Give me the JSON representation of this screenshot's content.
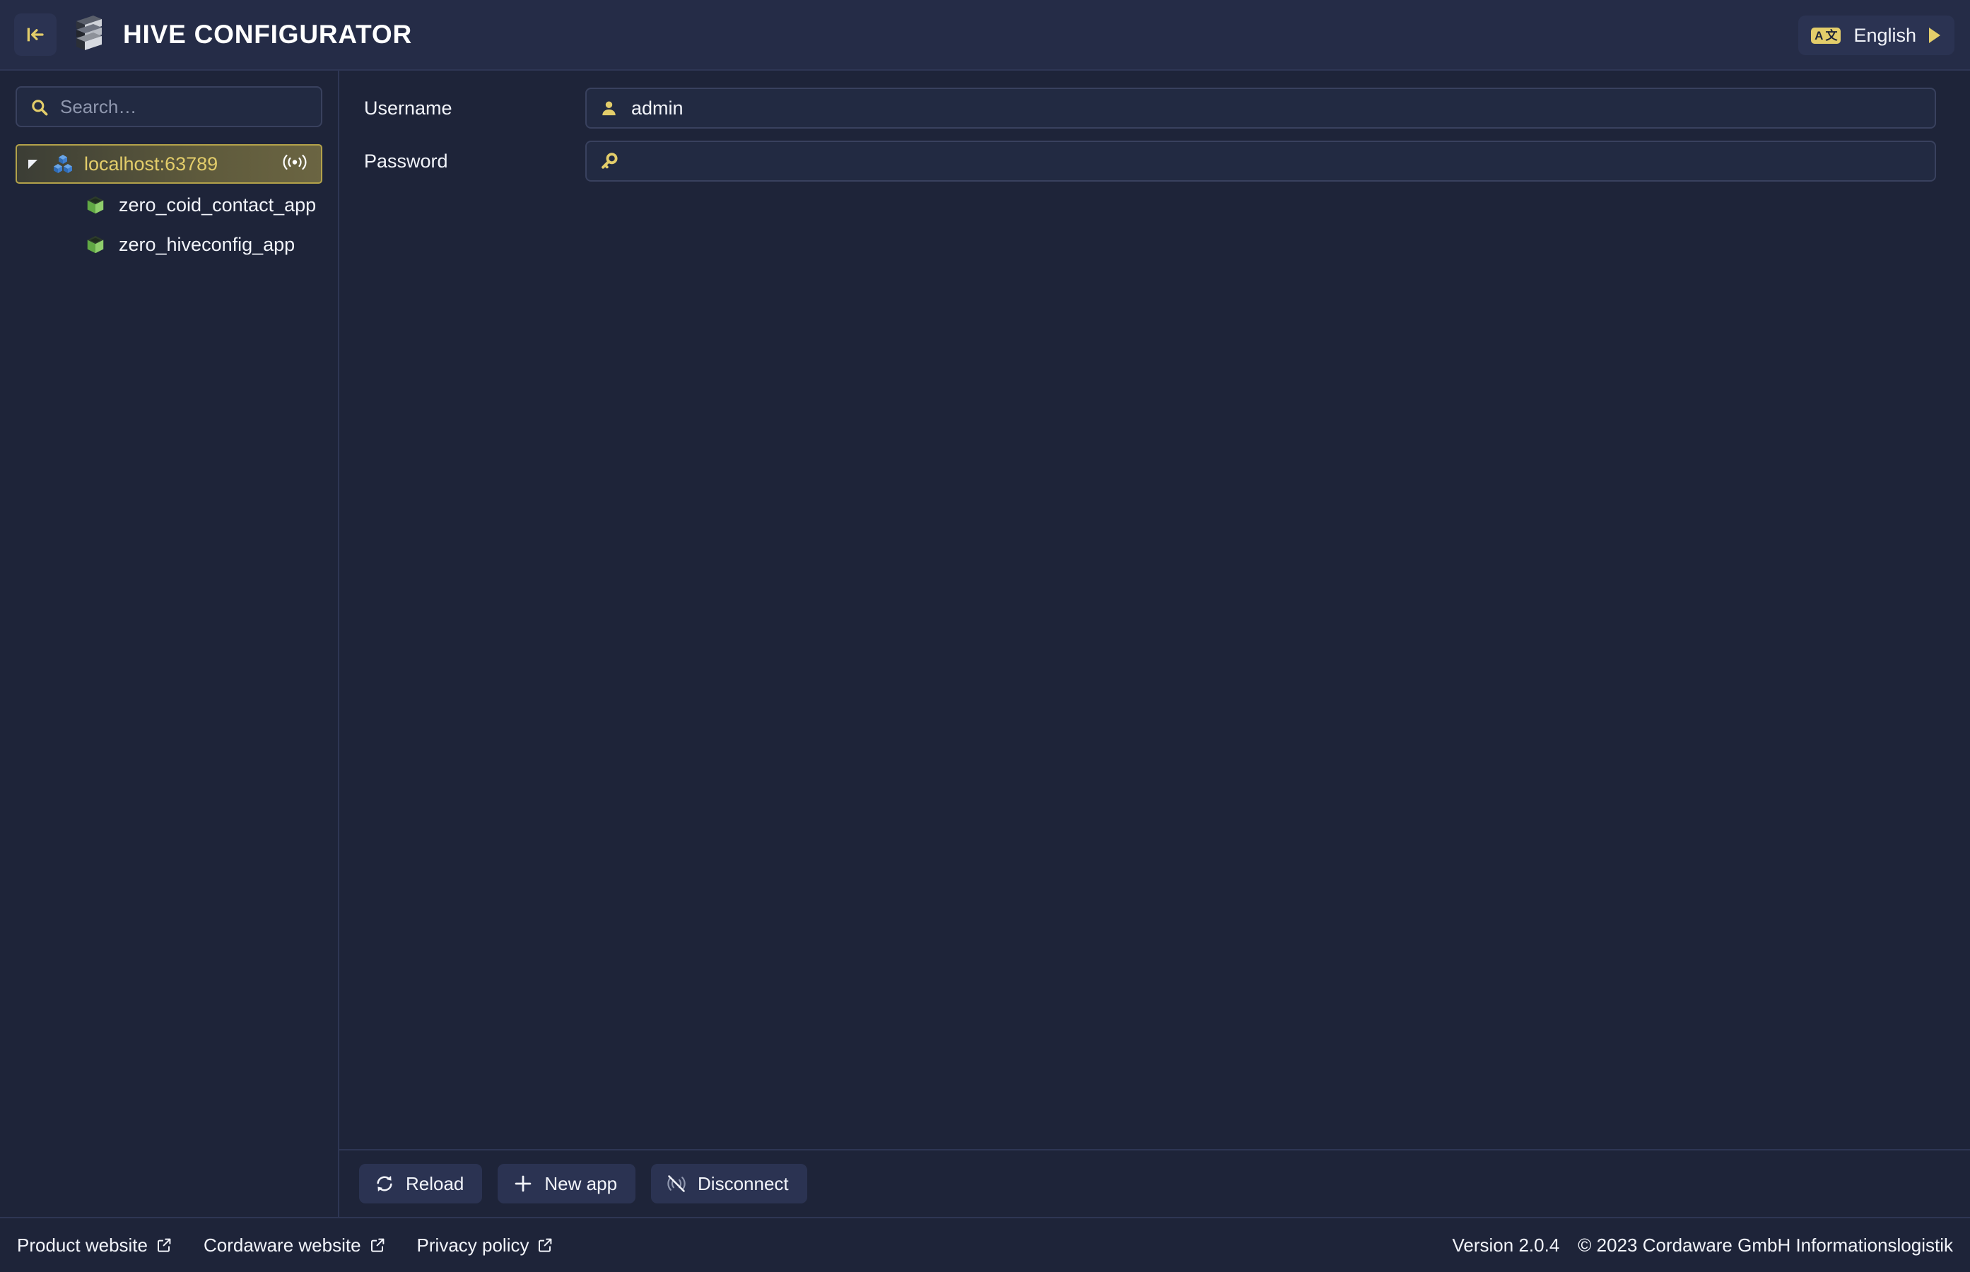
{
  "header": {
    "title": "HIVE CONFIGURATOR",
    "collapse_icon": "collapse-left-icon",
    "logo_icon": "hive-blocks-logo",
    "language": {
      "badge_left": "A",
      "badge_right": "文",
      "label": "English",
      "caret_icon": "caret-right-icon"
    }
  },
  "sidebar": {
    "search": {
      "placeholder": "Search…",
      "value": "",
      "icon": "search-icon"
    },
    "tree": {
      "server": {
        "label": "localhost:63789",
        "expanded": true,
        "expand_icon": "triangle-expanded-icon",
        "node_icon": "cluster-cubes-icon",
        "status_icon": "connected-signal-icon",
        "selected": true
      },
      "apps": [
        {
          "label": "zero_coid_contact_app",
          "icon": "green-cube-icon"
        },
        {
          "label": "zero_hiveconfig_app",
          "icon": "green-cube-icon"
        }
      ]
    }
  },
  "main": {
    "fields": [
      {
        "label": "Username",
        "value": "admin",
        "placeholder": "",
        "icon": "user-icon"
      },
      {
        "label": "Password",
        "value": "",
        "placeholder": "",
        "icon": "key-icon"
      }
    ]
  },
  "toolbar": {
    "buttons": [
      {
        "label": "Reload",
        "icon": "refresh-icon"
      },
      {
        "label": "New app",
        "icon": "plus-icon"
      },
      {
        "label": "Disconnect",
        "icon": "disconnect-signal-icon"
      }
    ]
  },
  "footer": {
    "links": [
      {
        "label": "Product website",
        "icon": "external-link-icon"
      },
      {
        "label": "Cordaware website",
        "icon": "external-link-icon"
      },
      {
        "label": "Privacy policy",
        "icon": "external-link-icon"
      }
    ],
    "version": "Version 2.0.4",
    "copyright": "© 2023 Cordaware GmbH Informationslogistik"
  },
  "colors": {
    "background": "#1e2439",
    "header_bg": "#252c47",
    "panel": "#2b3352",
    "accent_yellow": "#e3cd6a",
    "selection_border": "#b3a24a",
    "app_green": "#79c25b",
    "server_blue": "#3f7fd0",
    "text": "#f2f4fa",
    "muted": "#8f97ae"
  }
}
